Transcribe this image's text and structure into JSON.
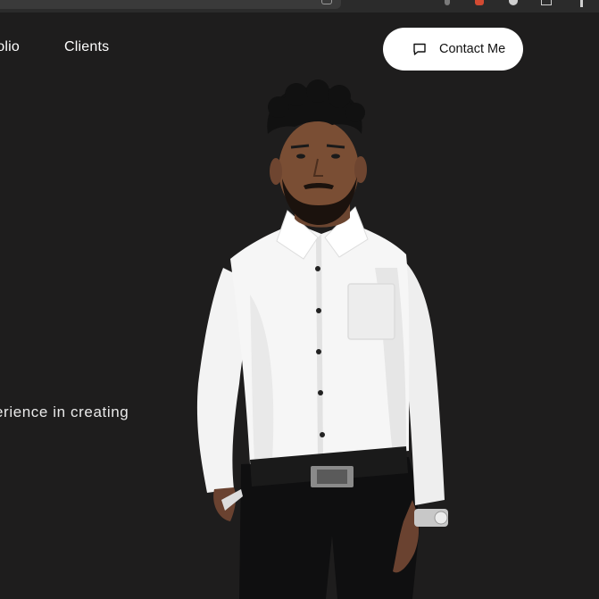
{
  "nav": {
    "items": [
      {
        "label": "tfolio"
      },
      {
        "label": "Clients"
      }
    ]
  },
  "contact_button": {
    "label": "Contact Me",
    "icon": "chat-bubble-icon"
  },
  "hero": {
    "text_fragment": "erience in creating"
  },
  "colors": {
    "background": "#1e1d1d",
    "button_bg": "#ffffff",
    "button_text": "#111111",
    "nav_text": "#ffffff"
  }
}
